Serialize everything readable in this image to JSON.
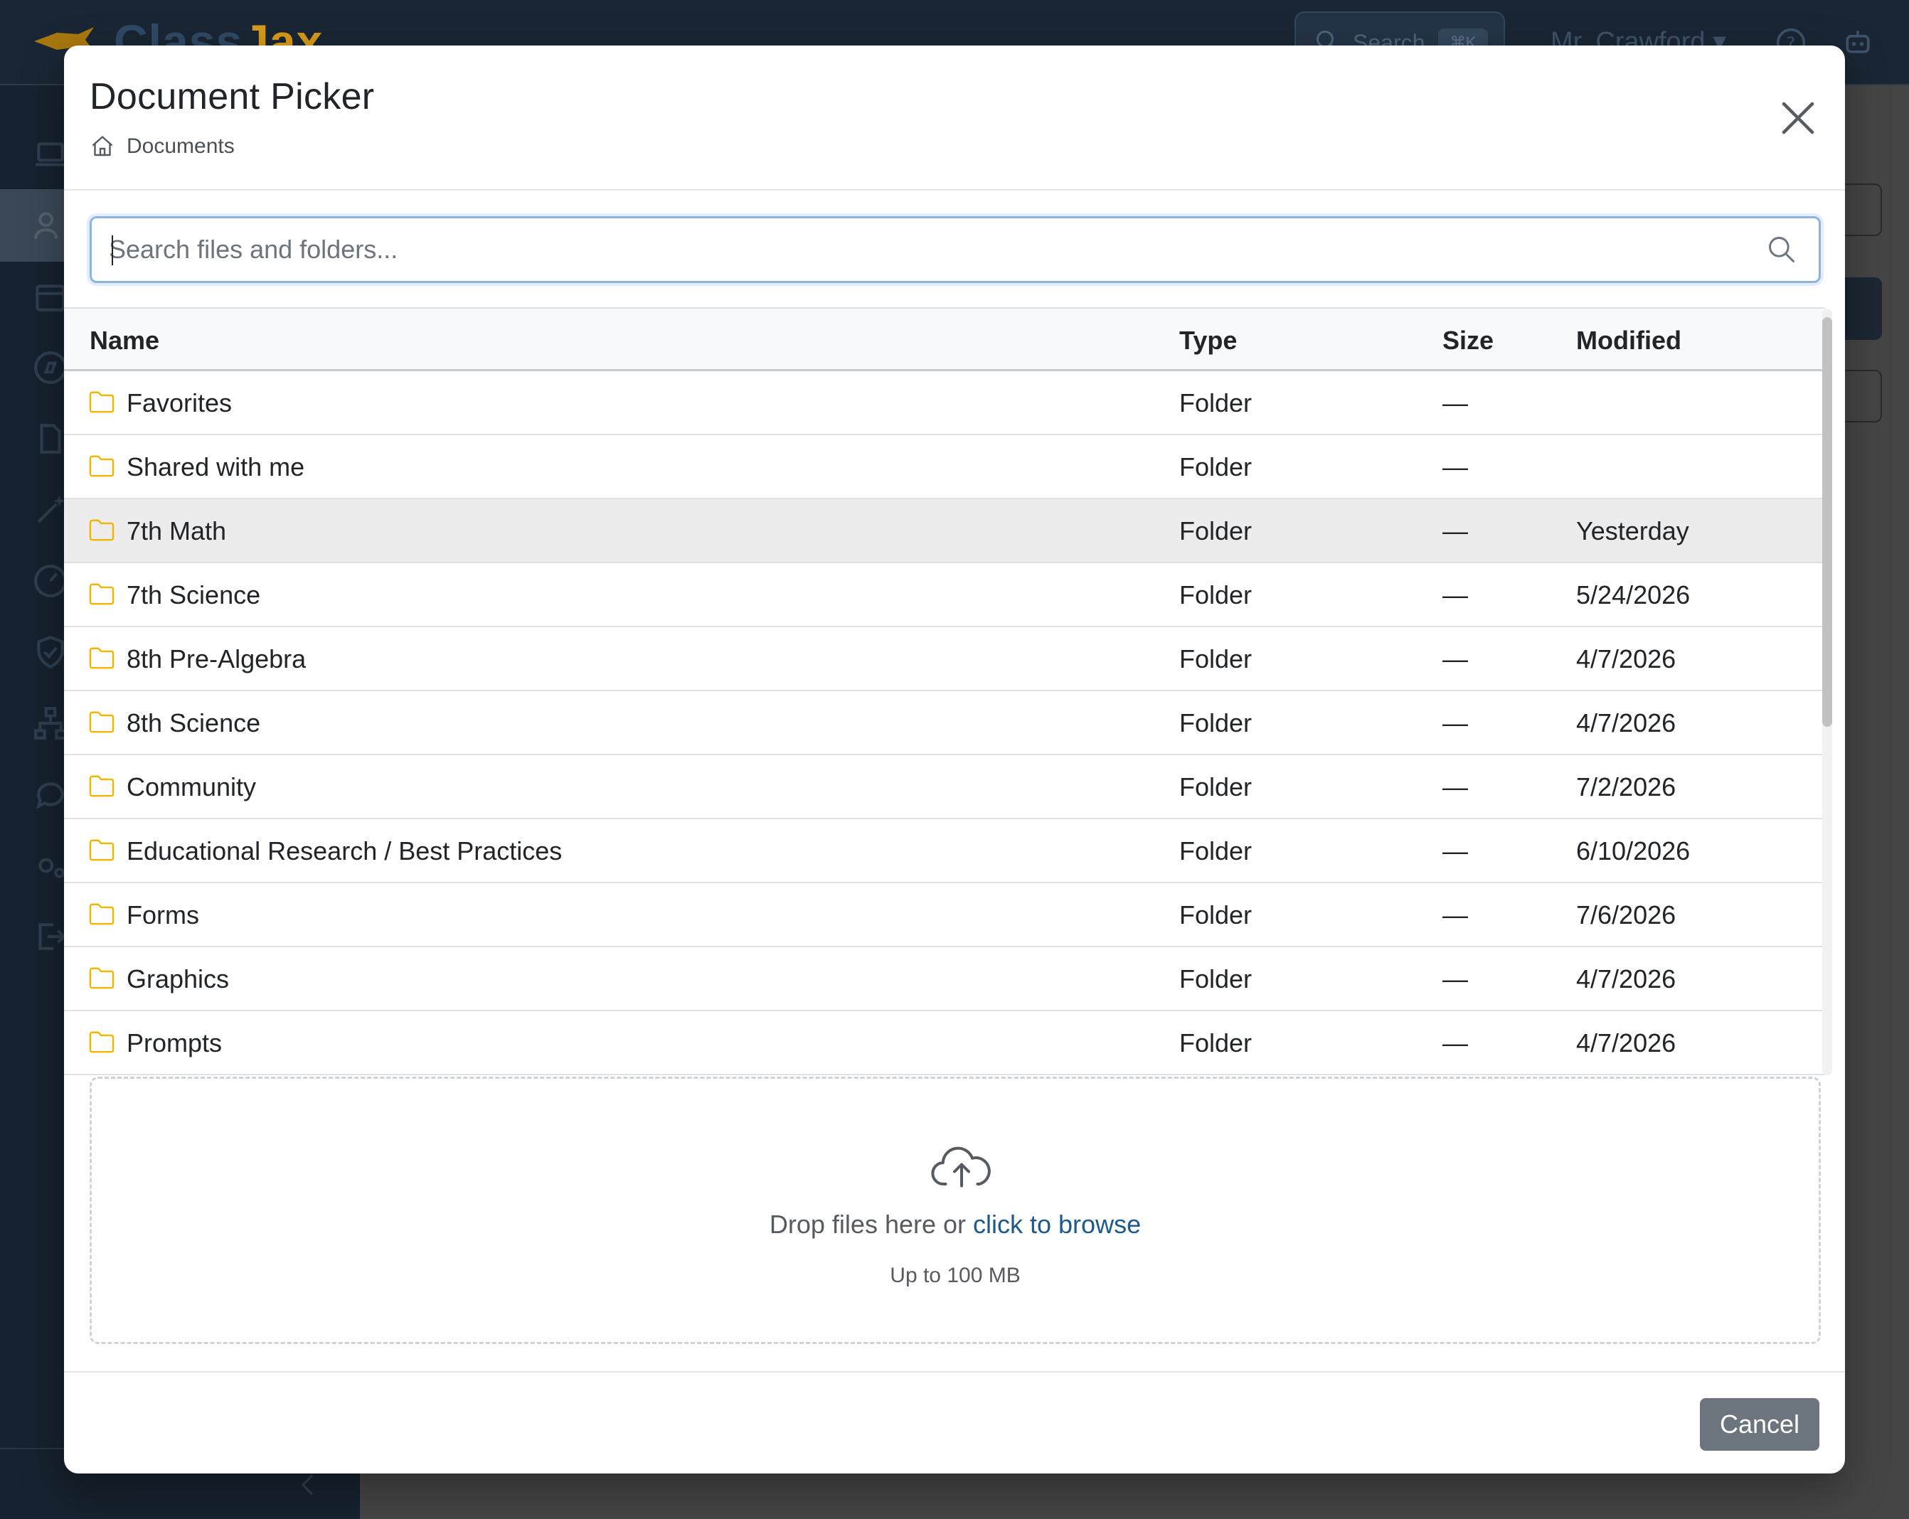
{
  "background_app": {
    "brand_name_part1": "Class",
    "brand_name_part2": "Jax",
    "search_label": "Search",
    "search_shortcut": "⌘K",
    "user_name": "Mr. Crawford"
  },
  "modal": {
    "title": "Document Picker",
    "breadcrumb": {
      "icon": "home-icon",
      "label": "Documents"
    },
    "close_icon": "close-icon",
    "search": {
      "placeholder": "Search files and folders...",
      "value": "",
      "icon": "search-icon"
    },
    "table": {
      "columns": {
        "name": "Name",
        "type": "Type",
        "size": "Size",
        "modified": "Modified"
      },
      "rows": [
        {
          "name": "Favorites",
          "type": "Folder",
          "size": "—",
          "modified": ""
        },
        {
          "name": "Shared with me",
          "type": "Folder",
          "size": "—",
          "modified": ""
        },
        {
          "name": "7th Math",
          "type": "Folder",
          "size": "—",
          "modified": "Yesterday",
          "hovered": true
        },
        {
          "name": "7th Science",
          "type": "Folder",
          "size": "—",
          "modified": "5/24/2026"
        },
        {
          "name": "8th Pre-Algebra",
          "type": "Folder",
          "size": "—",
          "modified": "4/7/2026"
        },
        {
          "name": "8th Science",
          "type": "Folder",
          "size": "—",
          "modified": "4/7/2026"
        },
        {
          "name": "Community",
          "type": "Folder",
          "size": "—",
          "modified": "7/2/2026"
        },
        {
          "name": "Educational Research / Best Practices",
          "type": "Folder",
          "size": "—",
          "modified": "6/10/2026"
        },
        {
          "name": "Forms",
          "type": "Folder",
          "size": "—",
          "modified": "7/6/2026"
        },
        {
          "name": "Graphics",
          "type": "Folder",
          "size": "—",
          "modified": "4/7/2026"
        },
        {
          "name": "Prompts",
          "type": "Folder",
          "size": "—",
          "modified": "4/7/2026"
        }
      ]
    },
    "dropzone": {
      "icon": "cloud-upload-icon",
      "text": "Drop files here or ",
      "link": "click to browse",
      "subtext": "Up to 100 MB"
    },
    "footer": {
      "cancel_label": "Cancel"
    }
  },
  "colors": {
    "folder_icon": "#f2b600",
    "link": "#1f5a8c",
    "cancel_button": "#6c757d",
    "search_focus_border": "#8fb3d9",
    "hover_row": "#ececec"
  }
}
